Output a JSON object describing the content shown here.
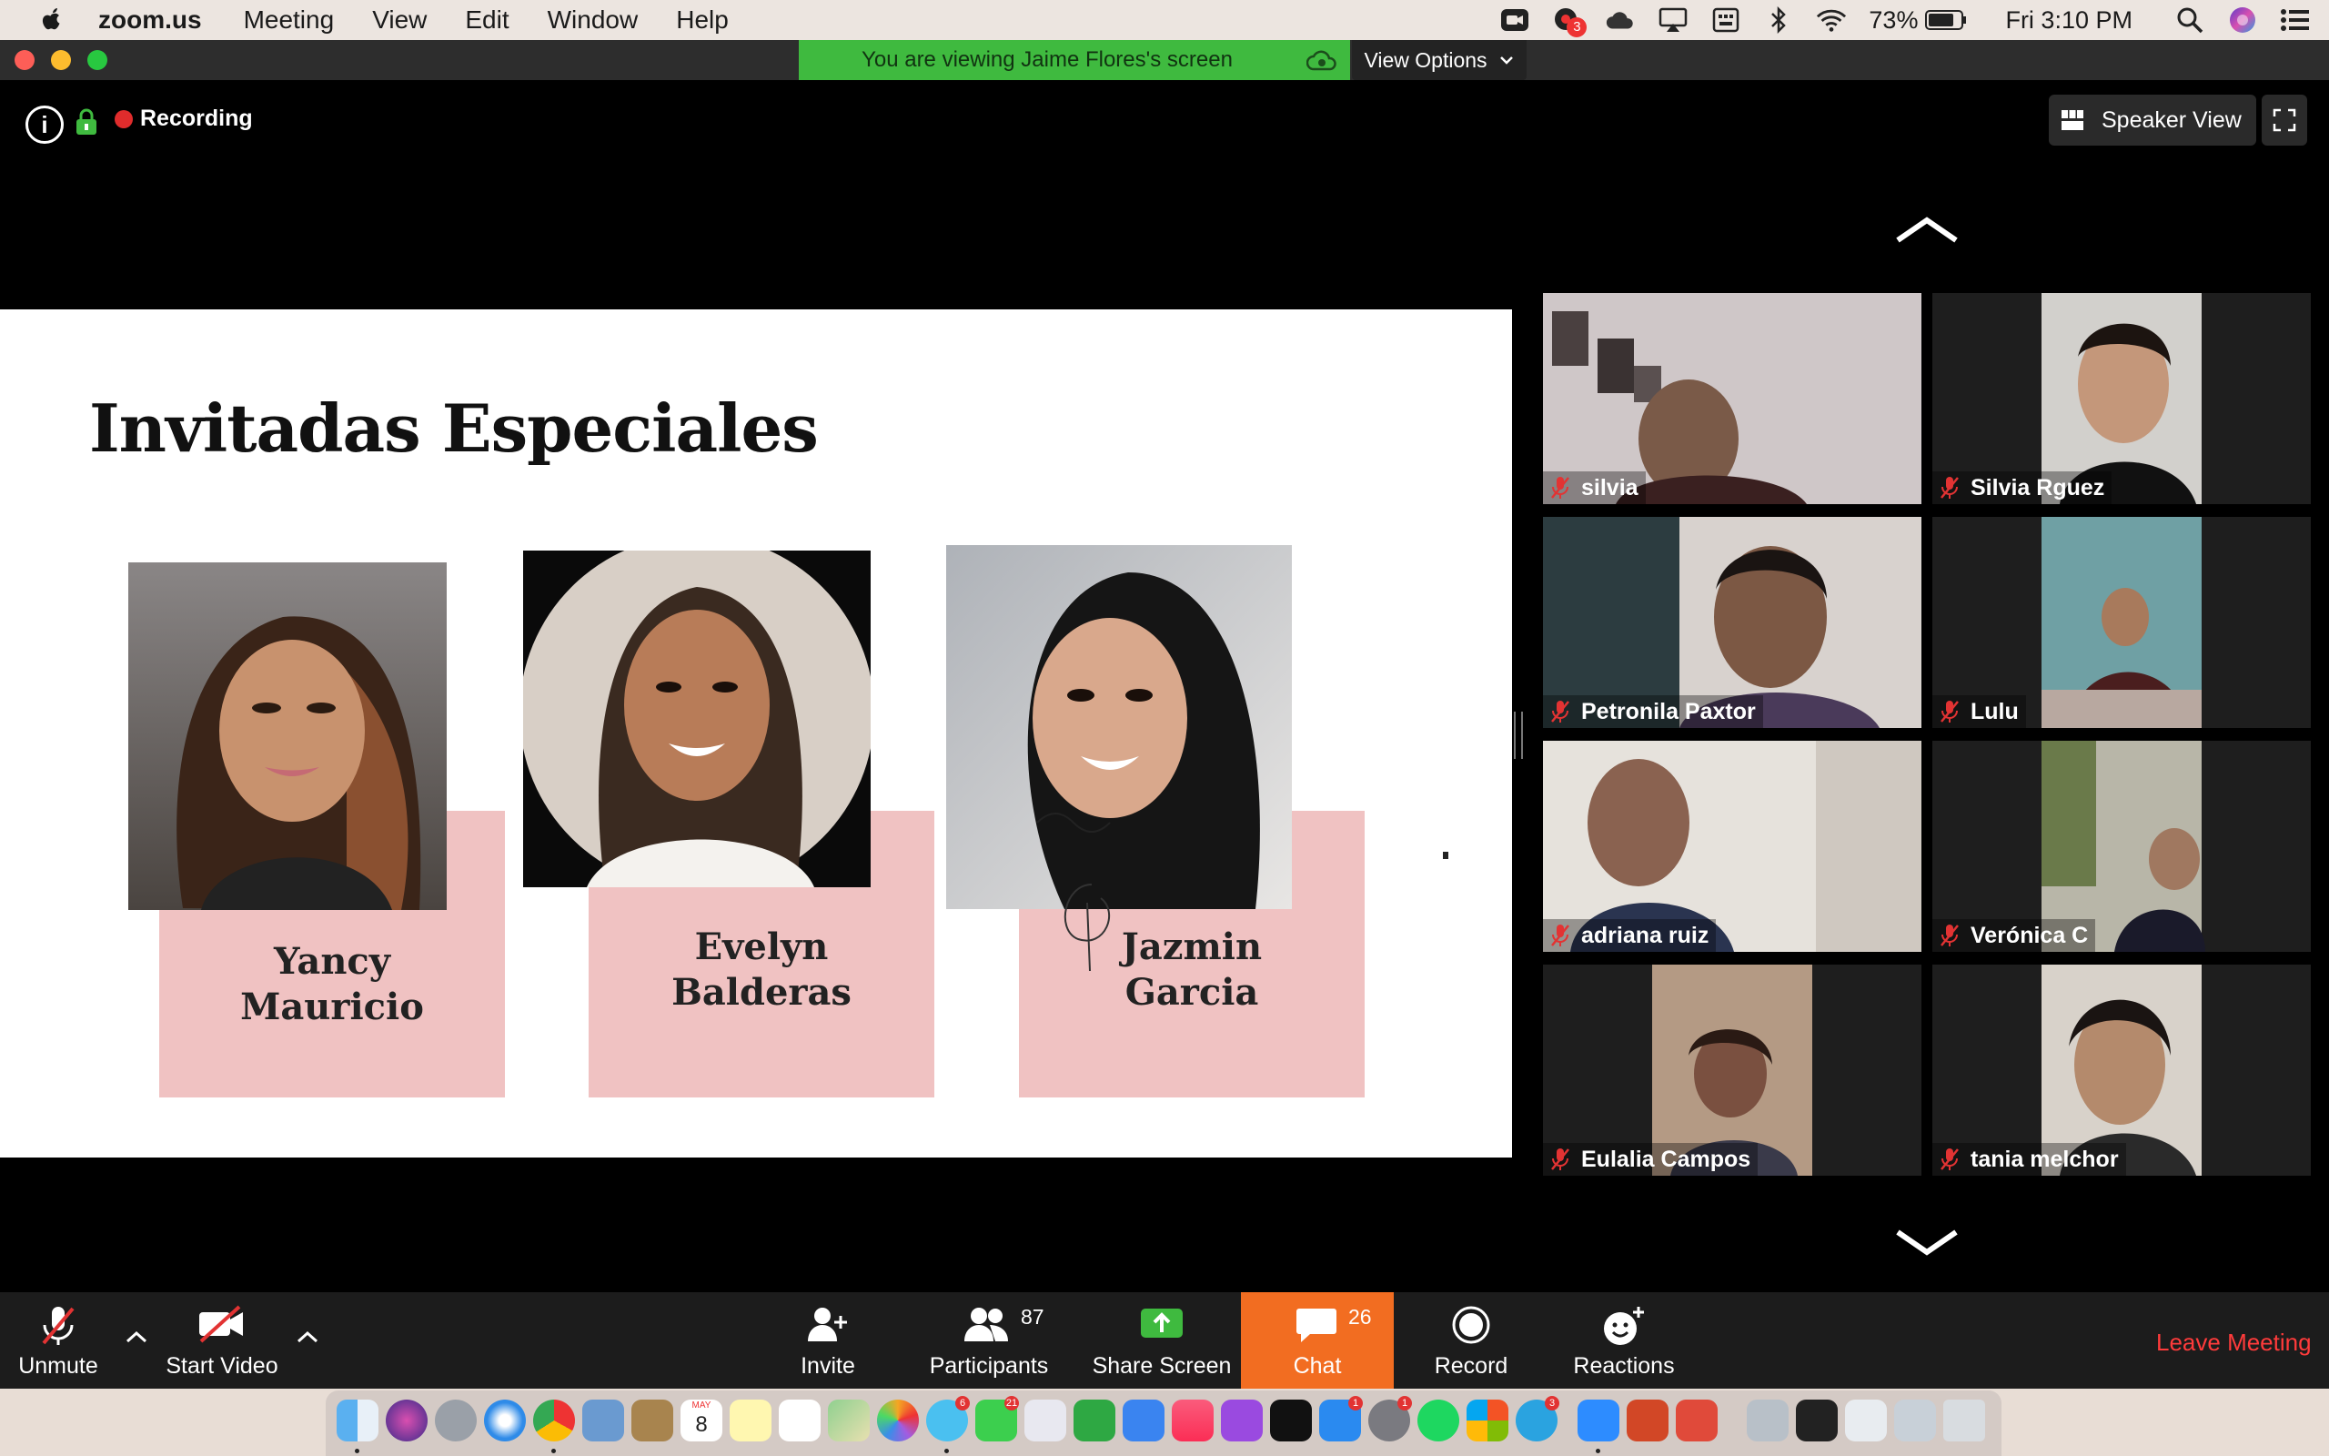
{
  "menubar": {
    "app_name": "zoom.us",
    "menus": [
      "Meeting",
      "View",
      "Edit",
      "Window",
      "Help"
    ],
    "battery": "73%",
    "clock": "Fri 3:10 PM",
    "notification_badge": "3"
  },
  "titlebar": {
    "banner_text": "You are viewing Jaime Flores's screen",
    "view_options_label": "View Options"
  },
  "meeting_bar": {
    "recording_label": "Recording",
    "speaker_view_label": "Speaker View"
  },
  "slide": {
    "title": "Invitadas Especiales",
    "guests": [
      {
        "first": "Yancy",
        "last": "Mauricio"
      },
      {
        "first": "Evelyn",
        "last": "Balderas"
      },
      {
        "first": "Jazmin",
        "last": "Garcia"
      }
    ],
    "card_color": "#f0c2c2"
  },
  "gallery": {
    "participants": [
      {
        "name": "silvia"
      },
      {
        "name": "Silvia Rguez"
      },
      {
        "name": "Petronila Paxtor"
      },
      {
        "name": "Lulu"
      },
      {
        "name": "adriana ruiz"
      },
      {
        "name": "Verónica C"
      },
      {
        "name": "Eulalia Campos"
      },
      {
        "name": "tania melchor"
      }
    ]
  },
  "toolbar": {
    "unmute_label": "Unmute",
    "start_video_label": "Start Video",
    "invite_label": "Invite",
    "participants_label": "Participants",
    "participants_count": "87",
    "share_screen_label": "Share Screen",
    "chat_label": "Chat",
    "chat_count": "26",
    "record_label": "Record",
    "reactions_label": "Reactions",
    "leave_label": "Leave Meeting"
  },
  "colors": {
    "share_green": "#3fba3f",
    "chat_orange": "#f26d21",
    "leave_red": "#ff3b3b",
    "recording_red": "#e02c2c"
  },
  "dock": {
    "calendar_month": "MAY",
    "calendar_day": "8",
    "badges": [
      "6",
      "21",
      "1",
      "1",
      "3"
    ]
  }
}
